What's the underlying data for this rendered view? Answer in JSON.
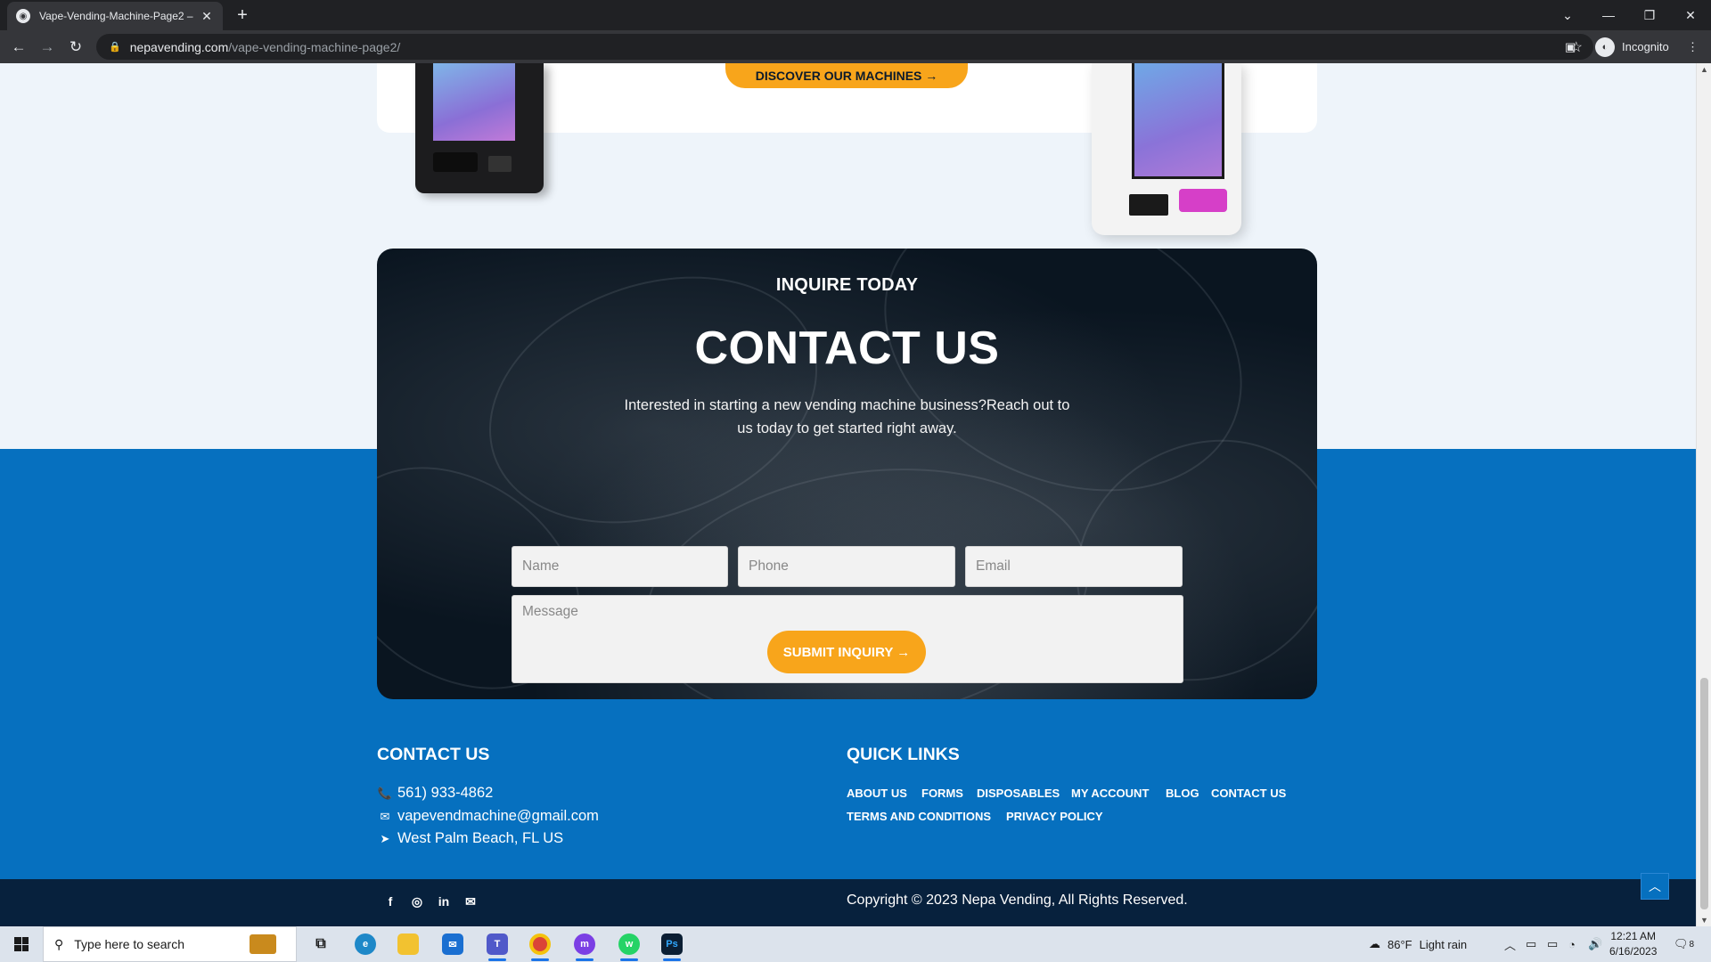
{
  "browser": {
    "tab_title": "Vape-Vending-Machine-Page2 –",
    "url_domain": "nepavending.com",
    "url_path": "/vape-vending-machine-page2/",
    "profile_label": "Incognito"
  },
  "hero": {
    "discover_label": "DISCOVER OUR MACHINES →"
  },
  "contact_section": {
    "eyebrow": "INQUIRE TODAY",
    "title": "CONTACT US",
    "blurb": "Interested in starting a new vending machine business?Reach out to us today to get started right away.",
    "name_placeholder": "Name",
    "phone_placeholder": "Phone",
    "email_placeholder": "Email",
    "message_placeholder": "Message",
    "submit_label": "SUBMIT INQUIRY →"
  },
  "footer": {
    "contact_heading": "CONTACT US",
    "phone": "561) 933-4862",
    "email": "vapevendmachine@gmail.com",
    "location": "West Palm Beach, FL US",
    "quick_links_heading": "QUICK LINKS",
    "quick_links": [
      "ABOUT US",
      "FORMS",
      "DISPOSABLES",
      "MY ACCOUNT",
      "BLOG",
      "CONTACT US",
      "TERMS AND CONDITIONS",
      "PRIVACY POLICY"
    ],
    "social_icons": [
      "facebook-icon",
      "instagram-icon",
      "linkedin-icon",
      "mail-icon"
    ],
    "copyright": "Copyright © 2023 Nepa Vending, All Rights Reserved."
  },
  "taskbar": {
    "search_placeholder": "Type here to search",
    "weather_temp": "86°F",
    "weather_desc": "Light rain",
    "time": "12:21 AM",
    "date": "6/16/2023",
    "notification_count": "8",
    "apps": [
      "task-view-icon",
      "edge-icon",
      "file-explorer-icon",
      "mail-icon",
      "teams-icon",
      "chrome-icon",
      "messenger-icon",
      "whatsapp-icon",
      "photoshop-icon"
    ]
  },
  "colors": {
    "accent_orange": "#f8a51b",
    "brand_blue": "#0670bf",
    "footer_navy": "#07213d"
  }
}
